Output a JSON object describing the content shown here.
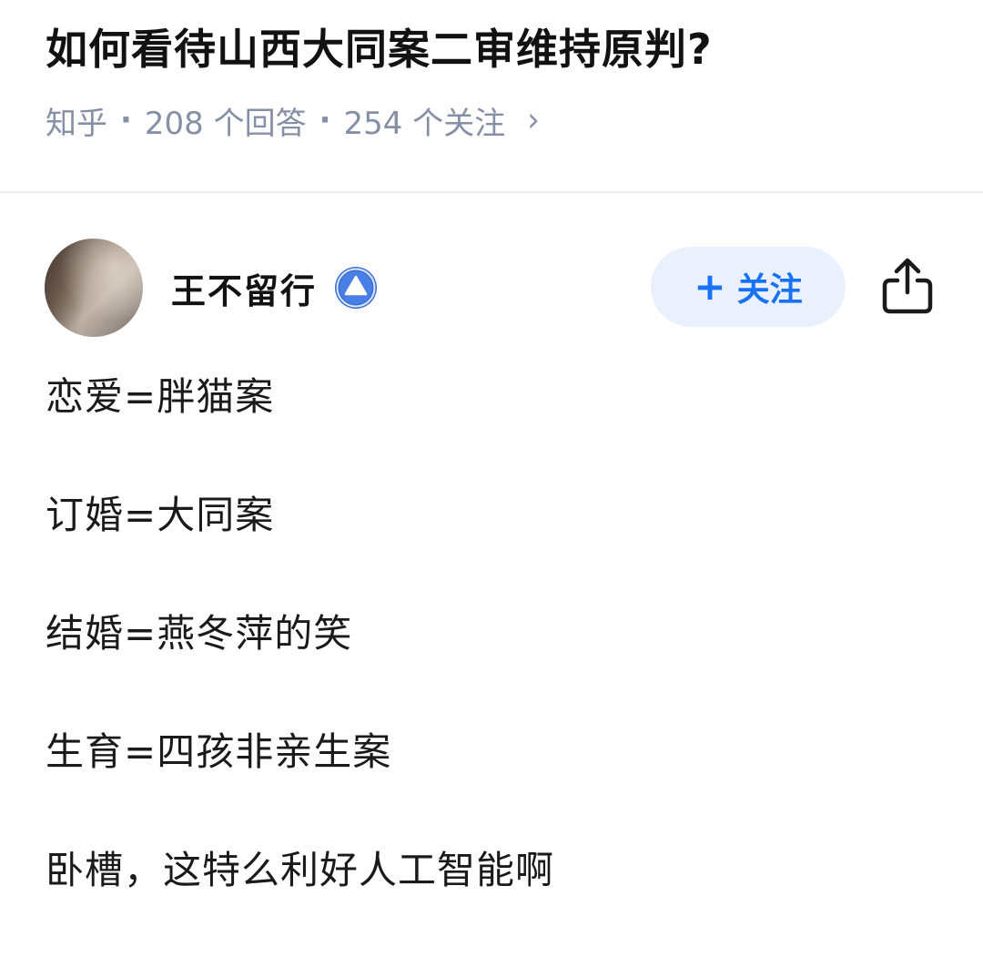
{
  "question": {
    "title": "如何看待山西大同案二审维持原判?",
    "source": "知乎",
    "separator": "·",
    "answers": "208 个回答",
    "followers": "254 个关注",
    "chevron": "›"
  },
  "answer": {
    "author": {
      "name": "王不留行",
      "badge_icon": "verified-badge-icon",
      "avatar_icon": "user-avatar"
    },
    "follow_button": {
      "plus": "+",
      "label": "关注"
    },
    "share_icon": "share-icon",
    "paragraphs": [
      "恋爱=胖猫案",
      "订婚=大同案",
      "结婚=燕冬萍的笑",
      "生育=四孩非亲生案",
      "卧槽，这特么利好人工智能啊"
    ]
  },
  "colors": {
    "accent": "#1772f6",
    "follow_bg": "#ebf0fd",
    "meta_gray": "#8590a6",
    "badge_blue": "#3b6fd8"
  }
}
